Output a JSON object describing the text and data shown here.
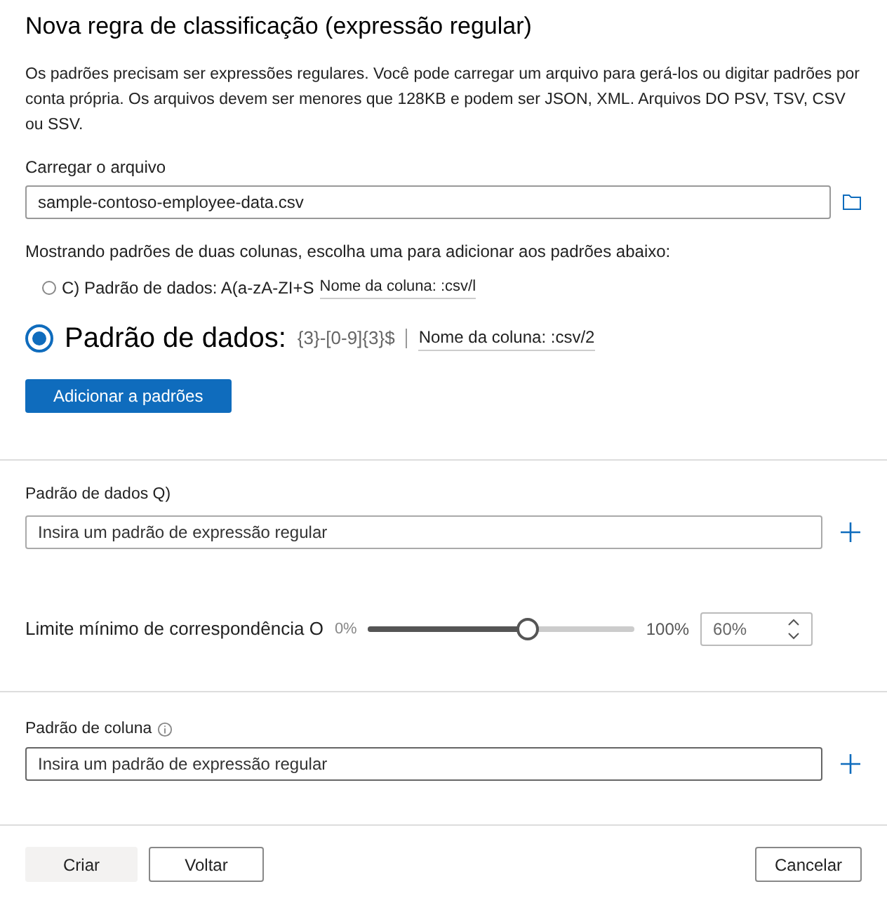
{
  "title": "Nova regra de classificação (expressão regular)",
  "description": "Os padrões precisam ser expressões regulares. Você pode carregar um arquivo para gerá-los ou digitar padrões por conta própria. Os arquivos devem ser menores que 128KB e podem ser JSON, XML. Arquivos DO PSV, TSV, CSV ou SSV.",
  "upload": {
    "label": "Carregar o arquivo",
    "value": "sample-contoso-employee-data.csv"
  },
  "columns_hint": "Mostrando padrões de duas colunas, escolha uma para adicionar aos padrões abaixo:",
  "options": [
    {
      "label": "C) Padrão de dados: A(a-zA-ZI+S",
      "column": "Nome da coluna: :csv/l",
      "selected": false
    },
    {
      "label": "Padrão de dados:",
      "pattern": "{3}-[0-9]{3}$",
      "column": "Nome da coluna: :csv/2",
      "selected": true
    }
  ],
  "add_button": "Adicionar a padrões",
  "data_pattern": {
    "label": "Padrão de dados Q)",
    "placeholder": "Insira um padrão de expressão regular"
  },
  "threshold": {
    "label": "Limite mínimo de correspondência O",
    "min": "0%",
    "max": "100%",
    "level": 0.6,
    "value": "60%"
  },
  "column_pattern": {
    "label": "Padrão de coluna",
    "placeholder": "Insira um padrão de expressão regular"
  },
  "buttons": {
    "create": "Criar",
    "back": "Voltar",
    "cancel": "Cancelar"
  }
}
